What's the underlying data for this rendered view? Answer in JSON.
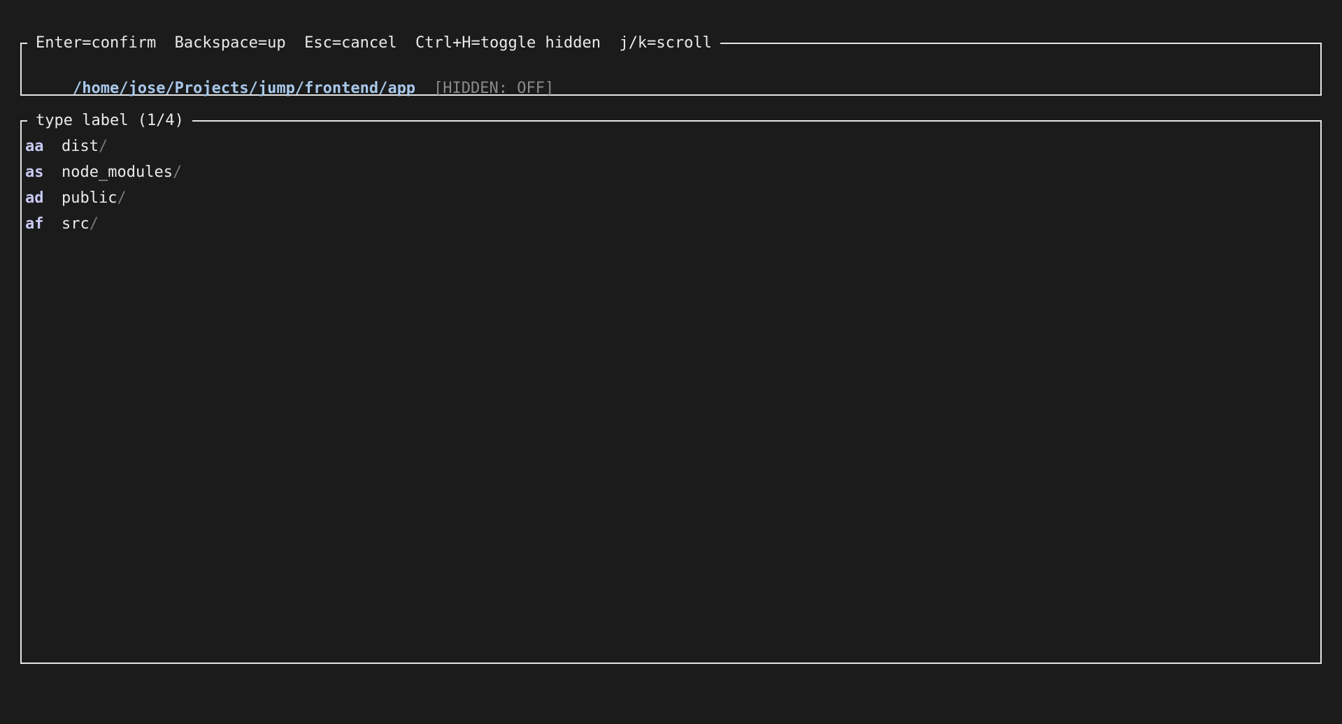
{
  "header": {
    "keybindings": "Enter=confirm  Backspace=up  Esc=cancel  Ctrl+H=toggle hidden  j/k=scroll",
    "path": "/home/jose/Projects/jump/frontend/app",
    "hidden_status": "[HIDDEN: OFF]"
  },
  "list": {
    "title": "type label (1/4)",
    "entries": [
      {
        "label": "aa",
        "name": "dist",
        "suffix": "/"
      },
      {
        "label": "as",
        "name": "node_modules",
        "suffix": "/"
      },
      {
        "label": "ad",
        "name": "public",
        "suffix": "/"
      },
      {
        "label": "af",
        "name": "src",
        "suffix": "/"
      }
    ]
  },
  "colors": {
    "background": "#1b1b1b",
    "border": "#e6e6e6",
    "path": "#a8c8ea",
    "label": "#c9c9f2",
    "muted": "#8a8a8a"
  }
}
